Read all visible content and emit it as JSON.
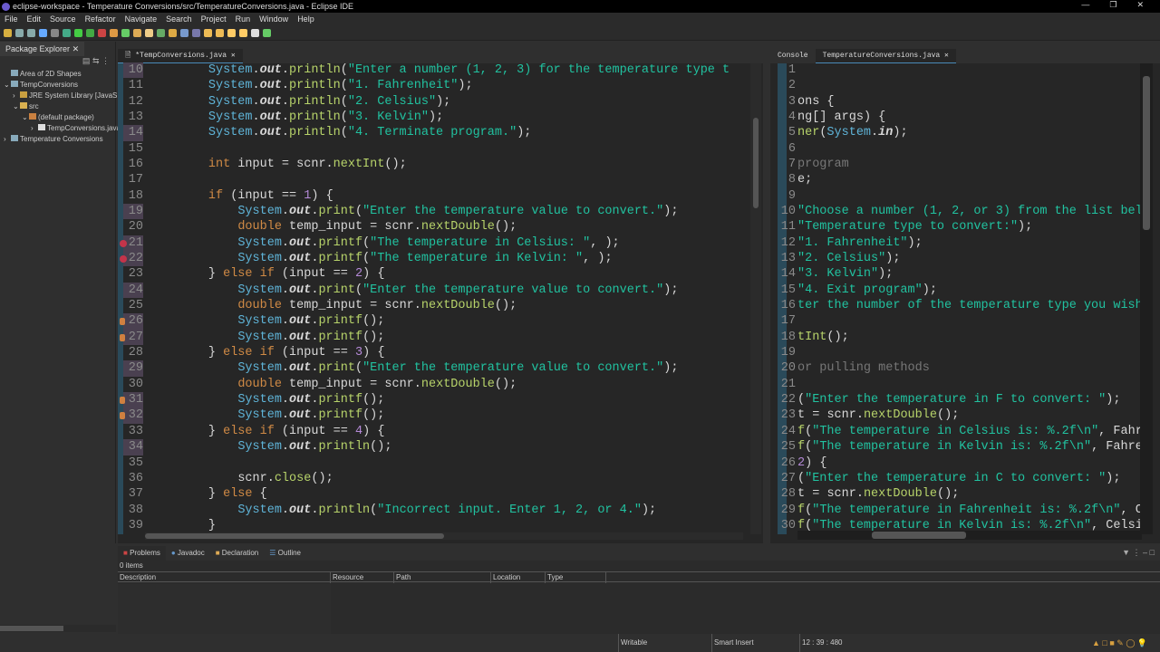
{
  "title": "eclipse-workspace - Temperature Conversions/src/TemperatureConversions.java - Eclipse IDE",
  "menu": [
    "File",
    "Edit",
    "Source",
    "Refactor",
    "Navigate",
    "Search",
    "Project",
    "Run",
    "Window",
    "Help"
  ],
  "package_explorer": {
    "tab": "Package Explorer",
    "items": [
      {
        "label": "Area of 2D Shapes",
        "depth": 0,
        "arrow": "",
        "icon": "project-icon"
      },
      {
        "label": "TempConversions",
        "depth": 0,
        "arrow": "v",
        "icon": "project-icon"
      },
      {
        "label": "JRE System Library [JavaSE",
        "depth": 1,
        "arrow": ">",
        "icon": "library-icon"
      },
      {
        "label": "src",
        "depth": 1,
        "arrow": "v",
        "icon": "folder-icon"
      },
      {
        "label": "(default package)",
        "depth": 2,
        "arrow": "v",
        "icon": "package-icon"
      },
      {
        "label": "TempConversions.java",
        "depth": 3,
        "arrow": ">",
        "icon": "java-file-icon"
      },
      {
        "label": "Temperature Conversions",
        "depth": 0,
        "arrow": ">",
        "icon": "project-icon"
      }
    ]
  },
  "left_editor": {
    "tab": "*TempConversions.java",
    "lines": [
      {
        "n": "10",
        "t": "        System.out.println(\"Enter a number (1, 2, 3) for the temperature type t",
        "mod": true
      },
      {
        "n": "11",
        "t": "        System.out.println(\"1. Fahrenheit\");"
      },
      {
        "n": "12",
        "t": "        System.out.println(\"2. Celsius\");"
      },
      {
        "n": "13",
        "t": "        System.out.println(\"3. Kelvin\");"
      },
      {
        "n": "14",
        "t": "        System.out.println(\"4. Terminate program.\");",
        "mod": true
      },
      {
        "n": "15",
        "t": ""
      },
      {
        "n": "16",
        "t": "        int input = scnr.nextInt();"
      },
      {
        "n": "17",
        "t": ""
      },
      {
        "n": "18",
        "t": "        if (input == 1) {"
      },
      {
        "n": "19",
        "t": "            System.out.print(\"Enter the temperature value to convert.\");",
        "mod": true
      },
      {
        "n": "20",
        "t": "            double temp_input = scnr.nextDouble();"
      },
      {
        "n": "21",
        "t": "            System.out.printf(\"The temperature in Celsius: \", );",
        "mod": true,
        "marker": "error"
      },
      {
        "n": "22",
        "t": "            System.out.printf(\"The temperature in Kelvin: \", );",
        "mod": true,
        "marker": "error"
      },
      {
        "n": "23",
        "t": "        } else if (input == 2) {"
      },
      {
        "n": "24",
        "t": "            System.out.print(\"Enter the temperature value to convert.\");",
        "mod": true
      },
      {
        "n": "25",
        "t": "            double temp_input = scnr.nextDouble();"
      },
      {
        "n": "26",
        "t": "            System.out.printf();",
        "mod": true,
        "marker": "warning"
      },
      {
        "n": "27",
        "t": "            System.out.printf();",
        "mod": true,
        "marker": "warning"
      },
      {
        "n": "28",
        "t": "        } else if (input == 3) {"
      },
      {
        "n": "29",
        "t": "            System.out.print(\"Enter the temperature value to convert.\");",
        "mod": true
      },
      {
        "n": "30",
        "t": "            double temp_input = scnr.nextDouble();"
      },
      {
        "n": "31",
        "t": "            System.out.printf();",
        "mod": true,
        "marker": "warning"
      },
      {
        "n": "32",
        "t": "            System.out.printf();",
        "mod": true,
        "marker": "warning"
      },
      {
        "n": "33",
        "t": "        } else if (input == 4) {"
      },
      {
        "n": "34",
        "t": "            System.out.println();",
        "mod": true
      },
      {
        "n": "35",
        "t": ""
      },
      {
        "n": "36",
        "t": "            scnr.close();"
      },
      {
        "n": "37",
        "t": "        } else {"
      },
      {
        "n": "38",
        "t": "            System.out.println(\"Incorrect input. Enter 1, 2, or 4.\");"
      },
      {
        "n": "39",
        "t": "        }"
      }
    ]
  },
  "right_editor": {
    "tabs": [
      "Console",
      "TemperatureConversions.java"
    ],
    "lines": [
      {
        "n": "1",
        "t": ""
      },
      {
        "n": "2",
        "t": ""
      },
      {
        "n": "3",
        "t": "ons {"
      },
      {
        "n": "4",
        "t": "ng[] args) {"
      },
      {
        "n": "5",
        "t": "ner(System.in);"
      },
      {
        "n": "6",
        "t": ""
      },
      {
        "n": "7",
        "t": "program",
        "kind": "c"
      },
      {
        "n": "8",
        "t": "e;"
      },
      {
        "n": "9",
        "t": ""
      },
      {
        "n": "10",
        "t": "\"Choose a number (1, 2, or 3) from the list belo"
      },
      {
        "n": "11",
        "t": "\"Temperature type to convert:\");"
      },
      {
        "n": "12",
        "t": "\"1. Fahrenheit\");"
      },
      {
        "n": "13",
        "t": "\"2. Celsius\");"
      },
      {
        "n": "14",
        "t": "\"3. Kelvin\");"
      },
      {
        "n": "15",
        "t": "\"4. Exit program\");"
      },
      {
        "n": "16",
        "t": "ter the number of the temperature type you wish",
        "kind": "s"
      },
      {
        "n": "17",
        "t": ""
      },
      {
        "n": "18",
        "t": "tInt();"
      },
      {
        "n": "19",
        "t": ""
      },
      {
        "n": "20",
        "t": "or pulling methods",
        "kind": "c"
      },
      {
        "n": "21",
        "t": ""
      },
      {
        "n": "22",
        "t": "(\"Enter the temperature in F to convert: \");"
      },
      {
        "n": "23",
        "t": "t = scnr.nextDouble();"
      },
      {
        "n": "24",
        "t": "f(\"The temperature in Celsius is: %.2f\\n\", Fahr"
      },
      {
        "n": "25",
        "t": "f(\"The temperature in Kelvin is: %.2f\\n\", Fahre"
      },
      {
        "n": "26",
        "t": "2) {"
      },
      {
        "n": "27",
        "t": "(\"Enter the temperature in C to convert: \");"
      },
      {
        "n": "28",
        "t": "t = scnr.nextDouble();"
      },
      {
        "n": "29",
        "t": "f(\"The temperature in Fahrenheit is: %.2f\\n\", C"
      },
      {
        "n": "30",
        "t": "f(\"The temperature in Kelvin is: %.2f\\n\", Celsi"
      }
    ]
  },
  "problems": {
    "tabs": [
      "Problems",
      "Javadoc",
      "Declaration",
      "Outline"
    ],
    "count": "0 items",
    "columns": [
      "Description",
      "Resource",
      "Path",
      "Location",
      "Type"
    ]
  },
  "status": {
    "writable": "Writable",
    "insert": "Smart Insert",
    "position": "12 : 39 : 480"
  }
}
